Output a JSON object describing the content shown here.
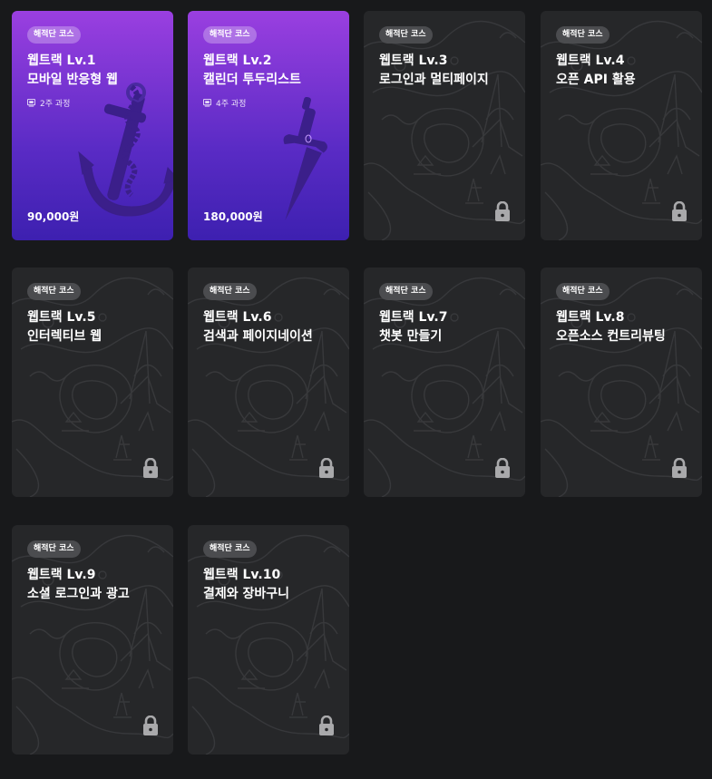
{
  "courses": [
    {
      "badge": "해적단 코스",
      "title_line1": "웹트랙 Lv.1",
      "title_line2": "모바일 반응형 웹",
      "duration": "2주 과정",
      "price": "90,000원",
      "status": "available",
      "icon": "anchor-icon"
    },
    {
      "badge": "해적단 코스",
      "title_line1": "웹트랙 Lv.2",
      "title_line2": "캘린더 투두리스트",
      "duration": "4주 과정",
      "price": "180,000원",
      "status": "available",
      "icon": "dagger-icon"
    },
    {
      "badge": "해적단 코스",
      "title_line1": "웹트랙 Lv.3",
      "title_line2": "로그인과 멀티페이지",
      "status": "locked",
      "icon": "lock-icon"
    },
    {
      "badge": "해적단 코스",
      "title_line1": "웹트랙 Lv.4",
      "title_line2": "오픈 API 활용",
      "status": "locked",
      "icon": "lock-icon"
    },
    {
      "badge": "해적단 코스",
      "title_line1": "웹트랙 Lv.5",
      "title_line2": "인터렉티브 웹",
      "status": "locked",
      "icon": "lock-icon"
    },
    {
      "badge": "해적단 코스",
      "title_line1": "웹트랙 Lv.6",
      "title_line2": "검색과 페이지네이션",
      "status": "locked",
      "icon": "lock-icon"
    },
    {
      "badge": "해적단 코스",
      "title_line1": "웹트랙 Lv.7",
      "title_line2": "챗봇 만들기",
      "status": "locked",
      "icon": "lock-icon"
    },
    {
      "badge": "해적단 코스",
      "title_line1": "웹트랙 Lv.8",
      "title_line2": "오픈소스 컨트리뷰팅",
      "status": "locked",
      "icon": "lock-icon"
    },
    {
      "badge": "해적단 코스",
      "title_line1": "웹트랙 Lv.9",
      "title_line2": "소셜 로그인과 광고",
      "status": "locked",
      "icon": "lock-icon"
    },
    {
      "badge": "해적단 코스",
      "title_line1": "웹트랙 Lv.10",
      "title_line2": "결제와 장바구니",
      "status": "locked",
      "icon": "lock-icon"
    }
  ],
  "colors": {
    "background": "#18191b",
    "card_locked": "#262729",
    "card_active_top": "#9a3fe0",
    "card_active_bottom": "#3d20b0"
  }
}
